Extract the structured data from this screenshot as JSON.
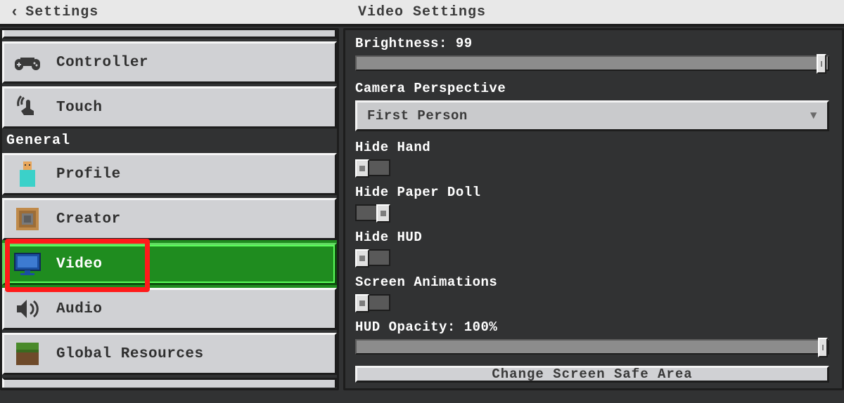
{
  "header": {
    "back_label": "Settings",
    "page_title": "Video Settings"
  },
  "sidebar": {
    "item_controller": "Controller",
    "item_touch": "Touch",
    "heading_general": "General",
    "item_profile": "Profile",
    "item_creator": "Creator",
    "item_video": "Video",
    "item_audio": "Audio",
    "item_global_resources": "Global Resources"
  },
  "content": {
    "brightness_label": "Brightness: 99",
    "brightness_pct": 99,
    "camera_perspective_label": "Camera Perspective",
    "camera_perspective_value": "First Person",
    "hide_hand_label": "Hide Hand",
    "hide_hand_on": false,
    "hide_paper_doll_label": "Hide Paper Doll",
    "hide_paper_doll_on": true,
    "hide_hud_label": "Hide HUD",
    "hide_hud_on": false,
    "screen_animations_label": "Screen Animations",
    "screen_animations_on": false,
    "hud_opacity_label": "HUD Opacity: 100%",
    "hud_opacity_pct": 100,
    "change_safe_area_label": "Change Screen Safe Area"
  }
}
